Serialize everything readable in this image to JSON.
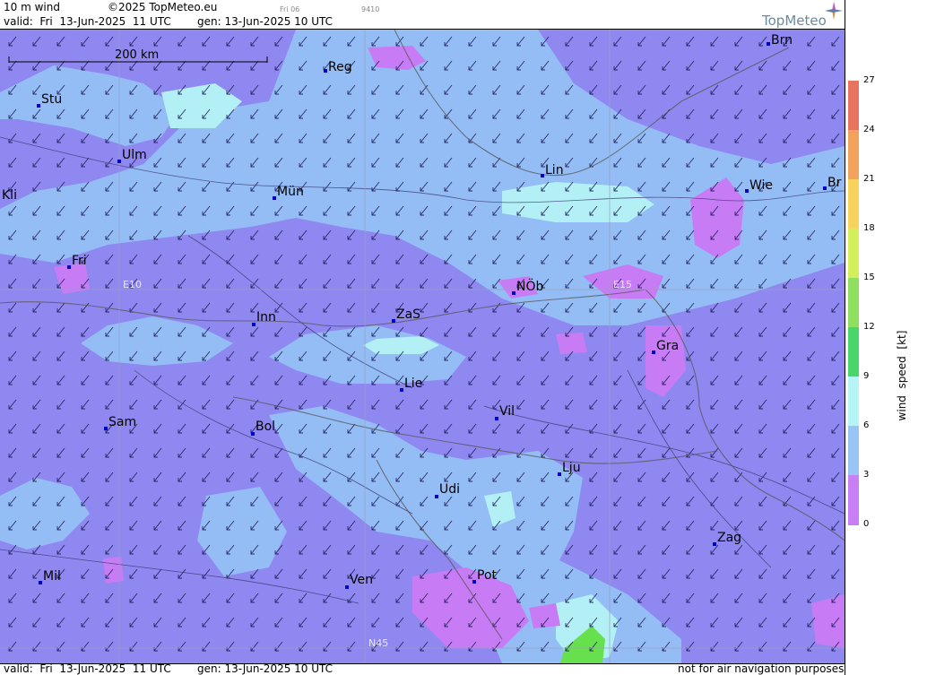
{
  "header": {
    "product": "10 m wind",
    "copyright": "©2025 TopMeteo.eu",
    "run_code": "Fri 06",
    "frame_code": "9410",
    "valid": "valid:  Fri  13-Jun-2025  11 UTC",
    "generated": "gen: 13-Jun-2025 10 UTC",
    "brand": "TopMeteo"
  },
  "footer": {
    "valid": "valid:  Fri  13-Jun-2025  11 UTC",
    "generated": "gen: 13-Jun-2025 10 UTC",
    "disclaimer": "not for air navigation purposes"
  },
  "map": {
    "scale_bar": "200 km",
    "grid_labels": [
      "E10",
      "E15",
      "N45"
    ],
    "cities": [
      "Brn",
      "Reg",
      "Stu",
      "Ulm",
      "Lin",
      "Kli",
      "Mün",
      "Wie",
      "Br",
      "Fri",
      "NÖb",
      "E15",
      "Inn",
      "ZaS",
      "Gra",
      "Lie",
      "Vil",
      "Sam",
      "Bol",
      "Lju",
      "Udi",
      "Zag",
      "Mil",
      "Ven",
      "Pot"
    ],
    "colors": {
      "calm": "#c77cf5",
      "light": "#9a85f2",
      "low": "#8f88f0",
      "mid": "#94bdf5",
      "high": "#b2f0f5",
      "green": "#66e04d"
    }
  },
  "legend": {
    "title": "wind  speed  [kt]",
    "ticks": [
      "27",
      "24",
      "21",
      "18",
      "15",
      "12",
      "9",
      "6",
      "3",
      "0"
    ],
    "colors": [
      "#e8735e",
      "#f2a25c",
      "#f5d35c",
      "#d4ef5c",
      "#8fe060",
      "#48d66a",
      "#b6f5f5",
      "#99c4f5",
      "#8c8af2",
      "#c87ef5"
    ]
  }
}
